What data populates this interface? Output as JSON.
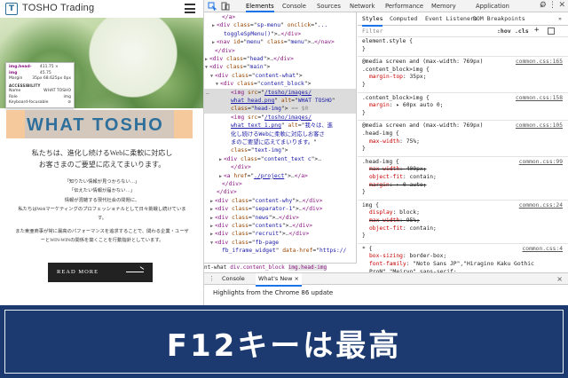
{
  "site": {
    "brand": "TOSHO Trading",
    "logo_letter": "T",
    "tooltip": {
      "tag": "img.head-img",
      "size": "411.75 × 45.75",
      "rows": [
        {
          "label": "Margin",
          "value": "35px 68.625px 0px"
        },
        {
          "label": "ACCESSIBILITY",
          "value": ""
        },
        {
          "label": "Name",
          "value": "WHAT TOSHO"
        },
        {
          "label": "Role",
          "value": "img"
        },
        {
          "label": "Keyboard-focusable",
          "value": "⊘"
        }
      ]
    },
    "heading_logo": "WHAT TOSHO",
    "lead_lines": [
      "私たちは、進化し続けるWebに柔軟に対応し",
      "お客さまのご要望に応えてまいります。"
    ],
    "body_lines": [
      "「知りたい情報が見つからない…」",
      "「伝えたい情報が届かない…」",
      "情報が混雑する現代社会の問題に、",
      "私たちはWebマーケティングのプロフェッショナルとして日々挑戦し続けていま",
      "す。",
      "また東亜商事が常に最高のパフォーマンスを追求することで、関わる企業・ユーザ",
      "ーとWIN-WINの関係を築くことを行動指針としています。"
    ],
    "button_label": "READ MORE"
  },
  "devtools": {
    "tabs": [
      "Elements",
      "Console",
      "Sources",
      "Network",
      "Performance",
      "Memory",
      "Application"
    ],
    "active_tab": "Elements",
    "overflow_label": "»",
    "elements_lines": [
      {
        "indent": 20,
        "html": "<span class='tg'>&lt;/a&gt;</span>"
      },
      {
        "indent": 16,
        "arrow": "▶",
        "html": "<span class='tg'>&lt;div</span> <span class='at'>class</span>=\"<span class='av'>sp-menu</span>\" <span class='at'>onclick</span>=\"<span class='av'>...</span>"
      },
      {
        "indent": 22,
        "html": "<span class='av'>toggleSpMenu()</span>\"&gt;<span class='dots'>…</span><span class='tg'>&lt;/div&gt;</span>"
      },
      {
        "indent": 16,
        "arrow": "▶",
        "html": "<span class='tg'>&lt;nav</span> <span class='at'>id</span>=\"<span class='av'>menu</span>\" <span class='at'>class</span>=\"<span class='av'>menu</span>\"&gt;<span class='dots'>…</span><span class='tg'>&lt;/nav&gt;</span>"
      },
      {
        "indent": 12,
        "html": "<span class='tg'>&lt;/div&gt;</span>"
      },
      {
        "indent": 8,
        "arrow": "▶",
        "html": "<span class='tg'>&lt;div</span> <span class='at'>class</span>=\"<span class='av'>head</span>\"&gt;<span class='dots'>…</span><span class='tg'>&lt;/div&gt;</span>"
      },
      {
        "indent": 8,
        "arrow": "▼",
        "html": "<span class='tg'>&lt;div</span> <span class='at'>class</span>=\"<span class='av'>main</span>\"&gt;"
      },
      {
        "indent": 14,
        "arrow": "▼",
        "html": "<span class='tg'>&lt;div</span> <span class='at'>class</span>=\"<span class='av'>content-what</span>\"&gt;"
      },
      {
        "indent": 20,
        "arrow": "▼",
        "html": "<span class='tg'>&lt;div</span> <span class='at'>class</span>=\"<span class='av'>content_block</span>\"&gt;"
      },
      {
        "indent": 30,
        "sel": true,
        "lead": "…",
        "html": "<span class='tg'>&lt;img</span> <span class='at'>src</span>=\"<span class='lk'>/tosho/images/</span>"
      },
      {
        "indent": 30,
        "sel": true,
        "html": "<span class='lk'>what_head.png</span>\" <span class='at'>alt</span>=\"<span class='av'>WHAT TOSHO</span>\""
      },
      {
        "indent": 30,
        "sel": true,
        "html": "<span class='at'>class</span>=\"<span class='av'>head-img</span>\"&gt; <span class='dollar'>== $0</span>"
      },
      {
        "indent": 30,
        "html": "<span class='tg'>&lt;img</span> <span class='at'>src</span>=\"<span class='lk'>/tosho/images/</span>"
      },
      {
        "indent": 30,
        "html": "<span class='lk'>what_text_1.png</span>\" <span class='at'>alt</span>=\"<span class='av'>我々は、進</span>"
      },
      {
        "indent": 30,
        "html": "<span class='av'>化し続けるWebに柔軟に対応しお客さ</span>"
      },
      {
        "indent": 30,
        "html": "<span class='av'>まのご要望に応えてまいります。</span>\""
      },
      {
        "indent": 30,
        "html": "<span class='at'>class</span>=\"<span class='av'>text-img</span>\"&gt;"
      },
      {
        "indent": 24,
        "arrow": "▶",
        "html": "<span class='tg'>&lt;div</span> <span class='at'>class</span>=\"<span class='av'>content_text c</span>\"&gt;<span class='dots'>…</span>"
      },
      {
        "indent": 30,
        "html": "<span class='tg'>&lt;/div&gt;</span>"
      },
      {
        "indent": 24,
        "arrow": "▶",
        "html": "<span class='tg'>&lt;a</span> <span class='at'>href</span>=\"<span class='lk'>./project</span>\"&gt;<span class='dots'>…</span><span class='tg'>&lt;/a&gt;</span>"
      },
      {
        "indent": 20,
        "html": "<span class='tg'>&lt;/div&gt;</span>"
      },
      {
        "indent": 14,
        "html": "<span class='tg'>&lt;/div&gt;</span>"
      },
      {
        "indent": 14,
        "arrow": "▶",
        "html": "<span class='tg'>&lt;div</span> <span class='at'>class</span>=\"<span class='av'>content-why</span>\"&gt;<span class='dots'>…</span><span class='tg'>&lt;/div&gt;</span>"
      },
      {
        "indent": 14,
        "arrow": "▶",
        "html": "<span class='tg'>&lt;div</span> <span class='at'>class</span>=\"<span class='av'>separator-1</span>\"&gt;<span class='dots'>…</span><span class='tg'>&lt;/div&gt;</span>"
      },
      {
        "indent": 14,
        "arrow": "▶",
        "html": "<span class='tg'>&lt;div</span> <span class='at'>class</span>=\"<span class='av'>news</span>\"&gt;<span class='dots'>…</span><span class='tg'>&lt;/div&gt;</span>"
      },
      {
        "indent": 14,
        "arrow": "▶",
        "html": "<span class='tg'>&lt;div</span> <span class='at'>class</span>=\"<span class='av'>contents</span>\"&gt;<span class='dots'>…</span><span class='tg'>&lt;/div&gt;</span>"
      },
      {
        "indent": 14,
        "arrow": "▶",
        "html": "<span class='tg'>&lt;div</span> <span class='at'>class</span>=\"<span class='av'>recruit</span>\"&gt;<span class='dots'>…</span><span class='tg'>&lt;/div&gt;</span>"
      },
      {
        "indent": 14,
        "arrow": "▼",
        "html": "<span class='tg'>&lt;div</span> <span class='at'>class</span>=\"<span class='av'>fb-page</span>"
      },
      {
        "indent": 20,
        "html": "<span class='av'>fb_iframe_widget</span>\" <span class='at'>data-href</span>=\"<span class='av'>https://</span>"
      }
    ],
    "breadcrumbs": [
      "nt-what",
      "div.content_block",
      "img.head-img"
    ],
    "styles": {
      "tabs": [
        "Styles",
        "Computed",
        "Event Listeners",
        "DOM Breakpoints"
      ],
      "tabs_more": "»",
      "filter_placeholder": "Filter",
      "hov": ":hov",
      "cls": ".cls",
      "plus": "+",
      "rules": [
        {
          "selector": "element.style {",
          "source": "",
          "props": [],
          "close": "}"
        },
        {
          "selector": "@media screen and (max-width: 769px)",
          "selector2": ".content_block>img {",
          "source": "common.css:165",
          "props": [
            {
              "n": "margin-top",
              "v": "35px;",
              "strike": false
            }
          ],
          "close": "}"
        },
        {
          "selector": ".content_block>img {",
          "source": "common.css:158",
          "props": [
            {
              "n": "margin",
              "v": "▸ 60px auto 0;",
              "strike": false
            }
          ],
          "close": "}"
        },
        {
          "selector": "@media screen and (max-width: 769px)",
          "selector2": ".head-img {",
          "source": "common.css:105",
          "props": [
            {
              "n": "max-width",
              "v": "75%;",
              "strike": false
            }
          ],
          "close": "}"
        },
        {
          "selector": ".head-img {",
          "source": "common.css:99",
          "props": [
            {
              "n": "max-width",
              "v": "400px;",
              "strike": true
            },
            {
              "n": "object-fit",
              "v": "contain;",
              "strike": false
            },
            {
              "n": "margin",
              "v": "▸ 0 auto;",
              "strike": true
            }
          ],
          "close": "}"
        },
        {
          "selector": "img {",
          "source": "common.css:24",
          "props": [
            {
              "n": "display",
              "v": "block;",
              "strike": false
            },
            {
              "n": "max-width",
              "v": "95%;",
              "strike": true
            },
            {
              "n": "object-fit",
              "v": "contain;",
              "strike": false
            }
          ],
          "close": "}"
        },
        {
          "selector": "* {",
          "source": "common.css:4",
          "props": [
            {
              "n": "box-sizing",
              "v": "border-box;",
              "strike": false
            },
            {
              "n": "font-family",
              "v": "\"Noto Sans JP\",\"Hiragino Kaku Gothic",
              "strike": false
            },
            {
              "n": "",
              "v": "ProN\",\"Meiryo\",sans-serif;",
              "strike": false
            }
          ],
          "close": ""
        }
      ]
    },
    "drawer": {
      "menu": "⋮",
      "tabs": [
        "Console",
        "What's New"
      ],
      "active": "What's New",
      "close_label": "×",
      "highlights": "Highlights from the Chrome 86 update"
    }
  },
  "banner": {
    "title": "F12キーは最高",
    "bg_color": "#1c3a70"
  }
}
